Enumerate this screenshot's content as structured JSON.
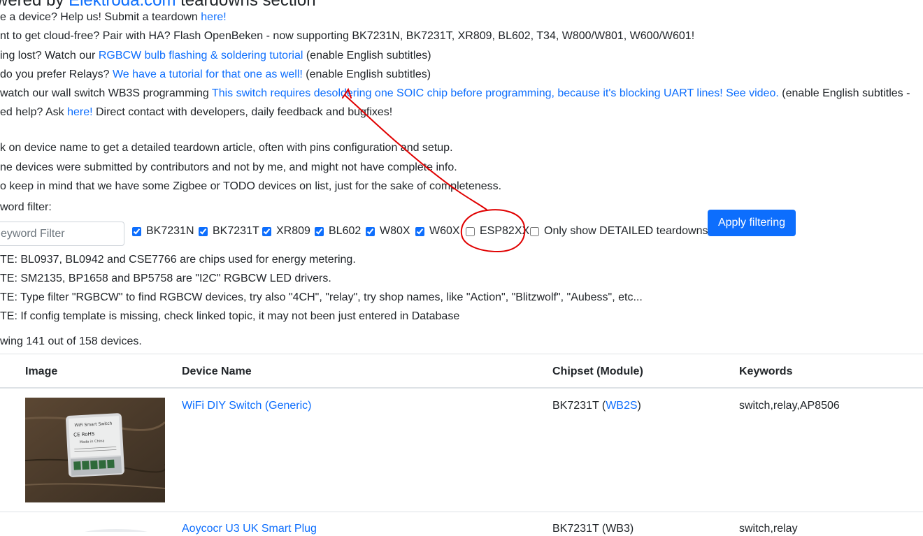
{
  "header": {
    "title_prefix": "wered by ",
    "title_link": "Elektroda.com",
    "title_suffix": " teardowns section"
  },
  "intro": [
    {
      "text": "e a device? Help us! Submit a teardown ",
      "link": "here!",
      "after": ""
    },
    {
      "text": "nt to get cloud-free? Pair with HA? Flash OpenBeken - now supporting BK7231N, BK7231T, XR809, BL602, T34, W800/W801, W600/W601!",
      "link": "",
      "after": ""
    },
    {
      "text": "ing lost? Watch our ",
      "link": "RGBCW bulb flashing & soldering tutorial",
      "after": " (enable English subtitles)"
    },
    {
      "text": "do you prefer Relays? ",
      "link": "We have a tutorial for that one as well!",
      "after": " (enable English subtitles)"
    },
    {
      "text": "watch our wall switch WB3S programming ",
      "link": "This switch requires desoldering one SOIC chip before programming, because it's blocking UART lines! See video.",
      "after": " (enable English subtitles - "
    },
    {
      "text": "ed help? Ask ",
      "link": "here!",
      "after": " Direct contact with developers, daily feedback and bugfixes!"
    }
  ],
  "notes": [
    "k on device name to get a detailed teardown article, often with pins configuration and setup.",
    "ne devices were submitted by contributors and not by me, and might not have complete info.",
    "o keep in mind that we have some Zigbee or TODO devices on list, just for the sake of completeness."
  ],
  "filter": {
    "label": "word filter:",
    "placeholder": "eyword Filter",
    "chips": [
      {
        "label": "BK7231N",
        "checked": true
      },
      {
        "label": "BK7231T",
        "checked": true
      },
      {
        "label": "XR809",
        "checked": true
      },
      {
        "label": "BL602",
        "checked": true
      },
      {
        "label": "W80X",
        "checked": true
      },
      {
        "label": "W60X",
        "checked": true
      },
      {
        "label": "ESP82XX",
        "checked": false
      }
    ],
    "detailed_label": "Only show DETAILED teardowns",
    "apply_label": "Apply filtering"
  },
  "tips": [
    "TE: BL0937, BL0942 and CSE7766 are chips used for energy metering.",
    "TE: SM2135, BP1658 and BP5758 are \"I2C\" RGBCW LED drivers.",
    "TE: Type filter \"RGBCW\" to find RGBCW devices, try also \"4CH\", \"relay\", try shop names, like \"Action\", \"Blitzwolf\", \"Aubess\", etc...",
    "TE: If config template is missing, check linked topic, it may not been just entered in Database"
  ],
  "count_text": "wing 141 out of 158 devices.",
  "table": {
    "headers": [
      "Image",
      "Device Name",
      "Chipset (Module)",
      "Keywords"
    ],
    "rows": [
      {
        "name": "WiFi DIY Switch (Generic)",
        "chip": "BK7231T (",
        "module": "WB2S",
        "chip_after": ")",
        "keywords": "switch,relay,AP8506"
      },
      {
        "name": "Aoycocr U3 UK Smart Plug",
        "chip": "BK7231T (",
        "module": "WB3",
        "chip_after": ")",
        "keywords": "switch,relay"
      }
    ]
  },
  "device_label": {
    "top": "WiFi Smart Switch",
    "mid": "Made in China",
    "marks": "CE  RoHS"
  },
  "colors": {
    "link": "#0d6efd",
    "button": "#0d6efd",
    "annotation": "#e00000"
  }
}
